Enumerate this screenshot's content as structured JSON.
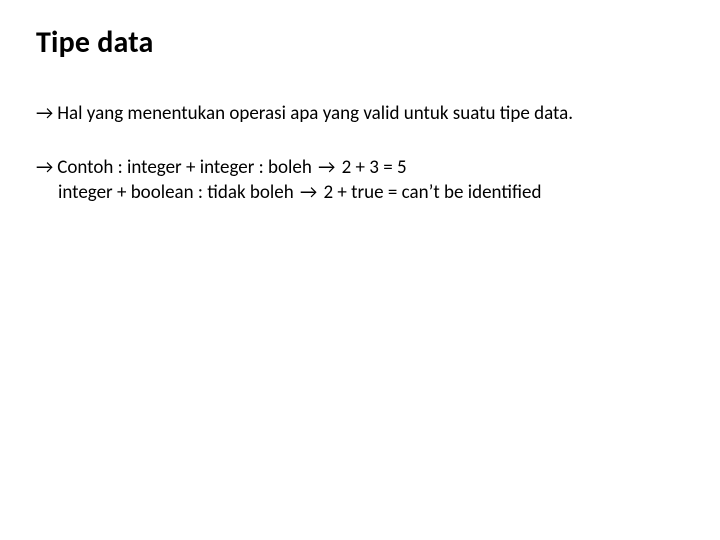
{
  "title": "Tipe data",
  "bullet1": {
    "arrow": "→",
    "text": "Hal yang menentukan operasi apa yang valid untuk suatu tipe data."
  },
  "bullet2": {
    "arrow": "→",
    "line1_pre": "Contoh : integer + integer : boleh ",
    "line1_arrow": "→",
    "line1_post": " 2 + 3 = 5",
    "line2_pre": "integer + boolean : tidak boleh ",
    "line2_arrow": "→",
    "line2_post": " 2 + true = can’t be identified"
  }
}
